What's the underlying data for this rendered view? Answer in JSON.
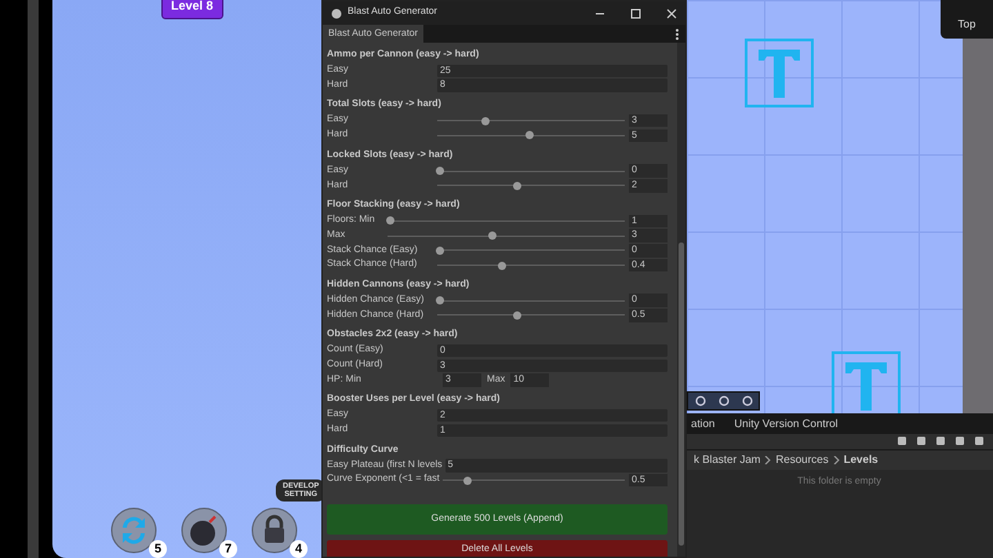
{
  "game_view": {
    "level_badge": "Level 8",
    "developer_badge": [
      "DEVELOP",
      "SETTING"
    ],
    "boosters": [
      {
        "kind": "shuffle",
        "count": "5"
      },
      {
        "kind": "bomb",
        "count": "7"
      },
      {
        "kind": "lock",
        "count": "4"
      }
    ]
  },
  "scene_view": {
    "view_label": "Top",
    "panel_tabs": [
      "ation",
      "Unity Version Control"
    ],
    "breadcrumb": [
      "k Blaster Jam",
      "Resources",
      "Levels"
    ],
    "empty_message": "This folder is empty"
  },
  "window": {
    "title": "Blast Auto Generator",
    "tab": "Blast Auto Generator",
    "sections": [
      {
        "title": "Ammo per Cannon (easy -> hard)",
        "rows": [
          {
            "kind": "field",
            "label": "Easy",
            "value": "25"
          },
          {
            "kind": "field",
            "label": "Hard",
            "value": "8"
          }
        ]
      },
      {
        "title": "Total Slots (easy -> hard)",
        "rows": [
          {
            "kind": "slider",
            "label": "Easy",
            "level": 0.24,
            "value": "3"
          },
          {
            "kind": "slider",
            "label": "Hard",
            "level": 0.48,
            "value": "5"
          }
        ]
      },
      {
        "title": "Locked Slots (easy -> hard)",
        "rows": [
          {
            "kind": "slider",
            "label": "Easy",
            "level": 0,
            "value": "0"
          },
          {
            "kind": "slider",
            "label": "Hard",
            "level": 0.41,
            "value": "2"
          }
        ]
      },
      {
        "title": "Floor Stacking (easy -> hard)",
        "rows": [
          {
            "kind": "wide-slider",
            "label": "Floors:  Min",
            "level": 0,
            "value": "1"
          },
          {
            "kind": "wide-slider",
            "label": "Max",
            "level": 0.43,
            "value": "3"
          },
          {
            "kind": "slider",
            "label": "Stack Chance (Easy)",
            "level": 0,
            "value": "0"
          },
          {
            "kind": "slider",
            "label": "Stack Chance (Hard)",
            "level": 0.33,
            "value": "0.4"
          }
        ]
      },
      {
        "title": "Hidden Cannons (easy -> hard)",
        "rows": [
          {
            "kind": "slider",
            "label": "Hidden Chance (Easy)",
            "level": 0,
            "value": "0"
          },
          {
            "kind": "slider",
            "label": "Hidden Chance (Hard)",
            "level": 0.41,
            "value": "0.5"
          }
        ]
      },
      {
        "title": "Obstacles 2x2 (easy -> hard)",
        "rows": [
          {
            "kind": "field",
            "label": "Count (Easy)",
            "value": "0"
          },
          {
            "kind": "field",
            "label": "Count (Hard)",
            "value": "3"
          },
          {
            "kind": "range",
            "label": "HP:  Min",
            "value": "3",
            "max_label": "Max",
            "max_value": "10"
          }
        ]
      },
      {
        "title": "Booster Uses per Level (easy -> hard)",
        "rows": [
          {
            "kind": "field",
            "label": "Easy",
            "value": "2"
          },
          {
            "kind": "field",
            "label": "Hard",
            "value": "1"
          }
        ]
      },
      {
        "title": "Difficulty Curve",
        "rows": [
          {
            "kind": "field",
            "label": "Easy Plateau (first N levels",
            "value": "5"
          },
          {
            "kind": "slider",
            "label": "Curve Exponent (<1 = fast",
            "level": 0.12,
            "value": "0.5"
          }
        ]
      }
    ],
    "buttons": [
      {
        "kind": "generate",
        "label": "Generate 500 Levels (Append)"
      },
      {
        "kind": "delete",
        "label": "Delete All Levels"
      }
    ]
  }
}
